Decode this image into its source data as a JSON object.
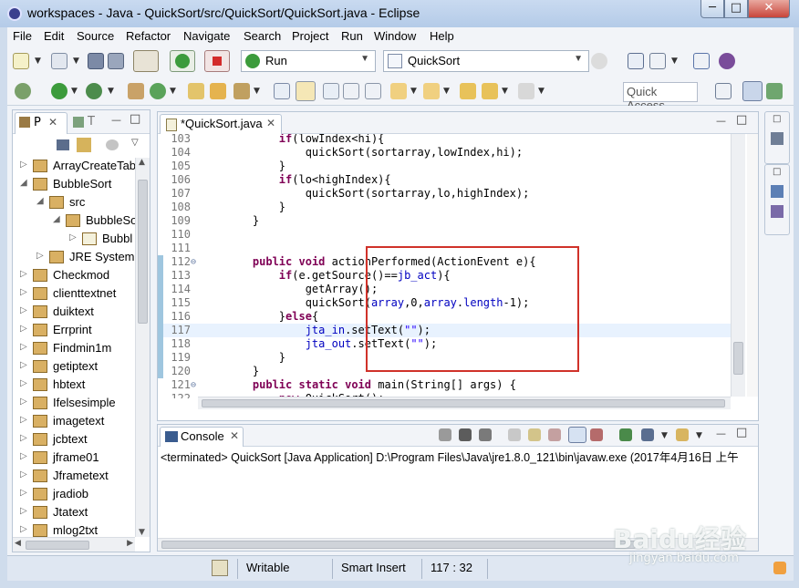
{
  "window": {
    "title": "workspaces - Java - QuickSort/src/QuickSort/QuickSort.java - Eclipse",
    "minimize": "─",
    "maximize": "□",
    "close": "✕"
  },
  "menu": [
    "File",
    "Edit",
    "Source",
    "Refactor",
    "Navigate",
    "Search",
    "Project",
    "Run",
    "Window",
    "Help"
  ],
  "toolbar": {
    "run_config": "Run",
    "launch_target": "QuickSort",
    "quick_access": "Quick Access"
  },
  "left_panel": {
    "tabs": [
      "P",
      "T"
    ],
    "items": [
      {
        "label": "ArrayCreateTab",
        "depth": 0,
        "expanded": false
      },
      {
        "label": "BubbleSort",
        "depth": 0,
        "expanded": true
      },
      {
        "label": "src",
        "depth": 1,
        "expanded": true
      },
      {
        "label": "BubbleSo",
        "depth": 2,
        "expanded": true
      },
      {
        "label": "Bubbl",
        "depth": 3,
        "expanded": false
      },
      {
        "label": "JRE System I",
        "depth": 1,
        "expanded": false
      },
      {
        "label": "Checkmod",
        "depth": 0,
        "expanded": false
      },
      {
        "label": "clienttextnet",
        "depth": 0,
        "expanded": false
      },
      {
        "label": "duiktext",
        "depth": 0,
        "expanded": false
      },
      {
        "label": "Errprint",
        "depth": 0,
        "expanded": false
      },
      {
        "label": "Findmin1m",
        "depth": 0,
        "expanded": false
      },
      {
        "label": "getiptext",
        "depth": 0,
        "expanded": false
      },
      {
        "label": "hbtext",
        "depth": 0,
        "expanded": false
      },
      {
        "label": "Ifelsesimple",
        "depth": 0,
        "expanded": false
      },
      {
        "label": "imagetext",
        "depth": 0,
        "expanded": false
      },
      {
        "label": "jcbtext",
        "depth": 0,
        "expanded": false
      },
      {
        "label": "jframe01",
        "depth": 0,
        "expanded": false
      },
      {
        "label": "Jframetext",
        "depth": 0,
        "expanded": false
      },
      {
        "label": "jradiob",
        "depth": 0,
        "expanded": false
      },
      {
        "label": "Jtatext",
        "depth": 0,
        "expanded": false
      },
      {
        "label": "mlog2txt",
        "depth": 0,
        "expanded": false
      }
    ]
  },
  "editor": {
    "tab_label": "*QuickSort.java",
    "lines": [
      {
        "num": "103",
        "code": "        if(lowIndex<hi){"
      },
      {
        "num": "104",
        "code": "            quickSort(sortarray,lowIndex,hi);"
      },
      {
        "num": "105",
        "code": "        }"
      },
      {
        "num": "106",
        "code": "        if(lo<highIndex){"
      },
      {
        "num": "107",
        "code": "            quickSort(sortarray,lo,highIndex);"
      },
      {
        "num": "108",
        "code": "        }"
      },
      {
        "num": "109",
        "code": "    }"
      },
      {
        "num": "110",
        "code": ""
      },
      {
        "num": "111",
        "code": ""
      },
      {
        "num": "112",
        "code": "    public void actionPerformed(ActionEvent e){"
      },
      {
        "num": "113",
        "code": "        if(e.getSource()==jb_act){"
      },
      {
        "num": "114",
        "code": "            getArray();"
      },
      {
        "num": "115",
        "code": "            quickSort(array,0,array.length-1);"
      },
      {
        "num": "116",
        "code": "        }else{"
      },
      {
        "num": "117",
        "code": "            jta_in.setText(\"\");"
      },
      {
        "num": "118",
        "code": "            jta_out.setText(\"\");"
      },
      {
        "num": "119",
        "code": "        }"
      },
      {
        "num": "120",
        "code": "    }"
      },
      {
        "num": "121",
        "code": "    public static void main(String[] args) {"
      },
      {
        "num": "122",
        "code": "        new QuickSort();"
      }
    ]
  },
  "console": {
    "tab_label": "Console",
    "output": "<terminated> QuickSort [Java Application] D:\\Program Files\\Java\\jre1.8.0_121\\bin\\javaw.exe (2017年4月16日 上午"
  },
  "statusbar": {
    "writable": "Writable",
    "insert_mode": "Smart Insert",
    "position": "117 : 32"
  },
  "watermark": {
    "brand": "Baidu经验",
    "url": "jingyan.baidu.com"
  },
  "colors": {
    "highlight_box": "#d0322a",
    "keyword": "#7f0055",
    "field": "#0000c0",
    "string": "#2a00ff"
  }
}
